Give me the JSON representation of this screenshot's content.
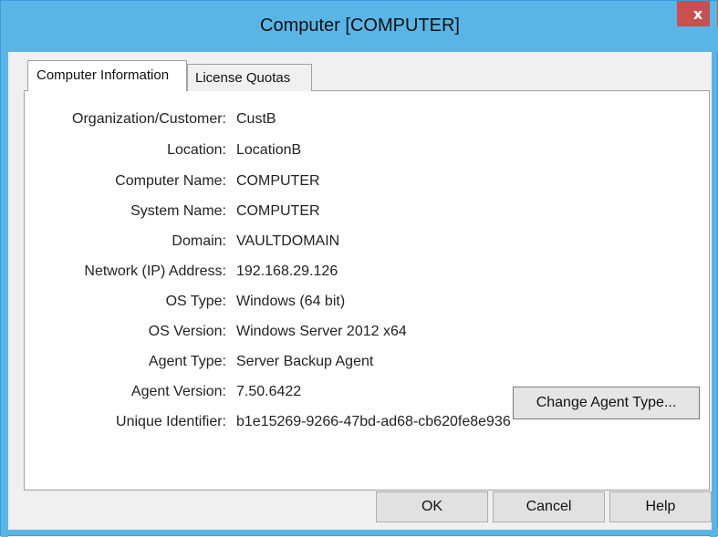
{
  "window": {
    "title": "Computer [COMPUTER]",
    "close_label": "x"
  },
  "tabs": [
    {
      "label": "Computer Information",
      "active": true
    },
    {
      "label": "License Quotas",
      "active": false
    }
  ],
  "fields": [
    {
      "label": "Organization/Customer:",
      "value": "CustB"
    },
    {
      "label": "Location:",
      "value": "LocationB"
    },
    {
      "label": "Computer Name:",
      "value": "COMPUTER"
    },
    {
      "label": "System Name:",
      "value": "COMPUTER"
    },
    {
      "label": "Domain:",
      "value": "VAULTDOMAIN"
    },
    {
      "label": "Network (IP) Address:",
      "value": "192.168.29.126"
    },
    {
      "label": "OS Type:",
      "value": "Windows (64 bit)"
    },
    {
      "label": "OS Version:",
      "value": "Windows Server 2012 x64"
    },
    {
      "label": "Agent Type:",
      "value": "Server Backup Agent"
    },
    {
      "label": "Agent Version:",
      "value": "7.50.6422"
    },
    {
      "label": "Unique Identifier:",
      "value": "b1e15269-9266-47bd-ad68-cb620fe8e936"
    }
  ],
  "buttons": {
    "change_agent_type": "Change Agent Type...",
    "ok": "OK",
    "cancel": "Cancel",
    "help": "Help"
  },
  "colors": {
    "title_bar": "#5ab5e6",
    "close_button": "#c75050"
  }
}
